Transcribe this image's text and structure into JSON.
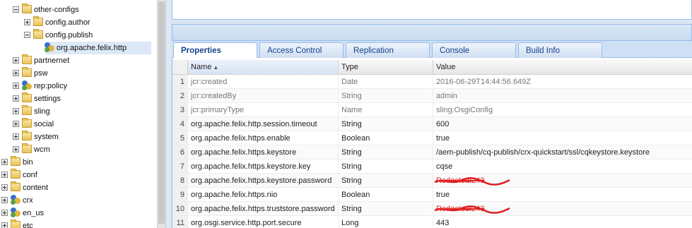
{
  "tree": {
    "items": [
      {
        "label": "other-configs",
        "level": 2,
        "toggle": "minus",
        "icon": "folder-icon"
      },
      {
        "label": "config.author",
        "level": 3,
        "toggle": "plus",
        "icon": "folder-icon"
      },
      {
        "label": "config.publish",
        "level": 3,
        "toggle": "minus",
        "icon": "folder-icon"
      },
      {
        "label": "org.apache.felix.http",
        "level": 4,
        "toggle": "none",
        "icon": "config-node-icon",
        "selected": true
      },
      {
        "label": "partnernet",
        "level": 2,
        "toggle": "plus",
        "icon": "folder-icon"
      },
      {
        "label": "psw",
        "level": 2,
        "toggle": "plus",
        "icon": "folder-icon"
      },
      {
        "label": "rep:policy",
        "level": 2,
        "toggle": "plus",
        "icon": "policy-node-icon"
      },
      {
        "label": "settings",
        "level": 2,
        "toggle": "plus",
        "icon": "folder-icon"
      },
      {
        "label": "sling",
        "level": 2,
        "toggle": "plus",
        "icon": "folder-icon"
      },
      {
        "label": "social",
        "level": 2,
        "toggle": "plus",
        "icon": "folder-icon"
      },
      {
        "label": "system",
        "level": 2,
        "toggle": "plus",
        "icon": "folder-icon"
      },
      {
        "label": "wcm",
        "level": 2,
        "toggle": "plus",
        "icon": "folder-icon"
      },
      {
        "label": "bin",
        "level": 1,
        "toggle": "plus",
        "icon": "folder-icon"
      },
      {
        "label": "conf",
        "level": 1,
        "toggle": "plus",
        "icon": "folder-icon"
      },
      {
        "label": "content",
        "level": 1,
        "toggle": "plus",
        "icon": "folder-icon"
      },
      {
        "label": "crx",
        "level": 1,
        "toggle": "plus",
        "icon": "config-node-icon"
      },
      {
        "label": "en_us",
        "level": 1,
        "toggle": "plus",
        "icon": "config-node-icon"
      },
      {
        "label": "etc",
        "level": 1,
        "toggle": "plus",
        "icon": "folder-icon"
      }
    ]
  },
  "tabs": [
    {
      "label": "Properties",
      "active": true
    },
    {
      "label": "Access Control",
      "active": false
    },
    {
      "label": "Replication",
      "active": false
    },
    {
      "label": "Console",
      "active": false
    },
    {
      "label": "Build Info",
      "active": false
    }
  ],
  "grid": {
    "columns": [
      "",
      "Name",
      "Type",
      "Value"
    ],
    "sort_indicator": "▲",
    "rows": [
      {
        "n": "1",
        "name": "jcr:created",
        "type": "Date",
        "value": "2016-06-29T14:44:56.649Z",
        "muted": true
      },
      {
        "n": "2",
        "name": "jcr:createdBy",
        "type": "String",
        "value": "admin",
        "muted": true
      },
      {
        "n": "3",
        "name": "jcr:primaryType",
        "type": "Name",
        "value": "sling:OsgiConfig",
        "muted": true
      },
      {
        "n": "4",
        "name": "org.apache.felix.http.session.timeout",
        "type": "String",
        "value": "600"
      },
      {
        "n": "5",
        "name": "org.apache.felix.https.enable",
        "type": "Boolean",
        "value": "true"
      },
      {
        "n": "6",
        "name": "org.apache.felix.https.keystore",
        "type": "String",
        "value": "/aem-publish/cq-publish/crx-quickstart/ssl/cqkeystore.keystore"
      },
      {
        "n": "7",
        "name": "org.apache.felix.https.keystore.key",
        "type": "String",
        "value": "cqse"
      },
      {
        "n": "8",
        "name": "org.apache.felix.https.keystore.password",
        "type": "String",
        "value": "R̶e̶d̶a̶c̶t̶e̶d̶f243",
        "redacted": true
      },
      {
        "n": "9",
        "name": "org.apache.felix.https.nio",
        "type": "Boolean",
        "value": "true"
      },
      {
        "n": "10",
        "name": "org.apache.felix.https.truststore.password",
        "type": "String",
        "value": "R̶e̶d̶a̶c̶t̶e̶d̶f243",
        "redacted": true
      },
      {
        "n": "11",
        "name": "org.osgi.service.http.port.secure",
        "type": "Long",
        "value": "443"
      }
    ]
  },
  "colors": {
    "accent": "#15428b",
    "border": "#99bbe8",
    "redaction": "#e02020",
    "selected": "#dde9f7"
  }
}
